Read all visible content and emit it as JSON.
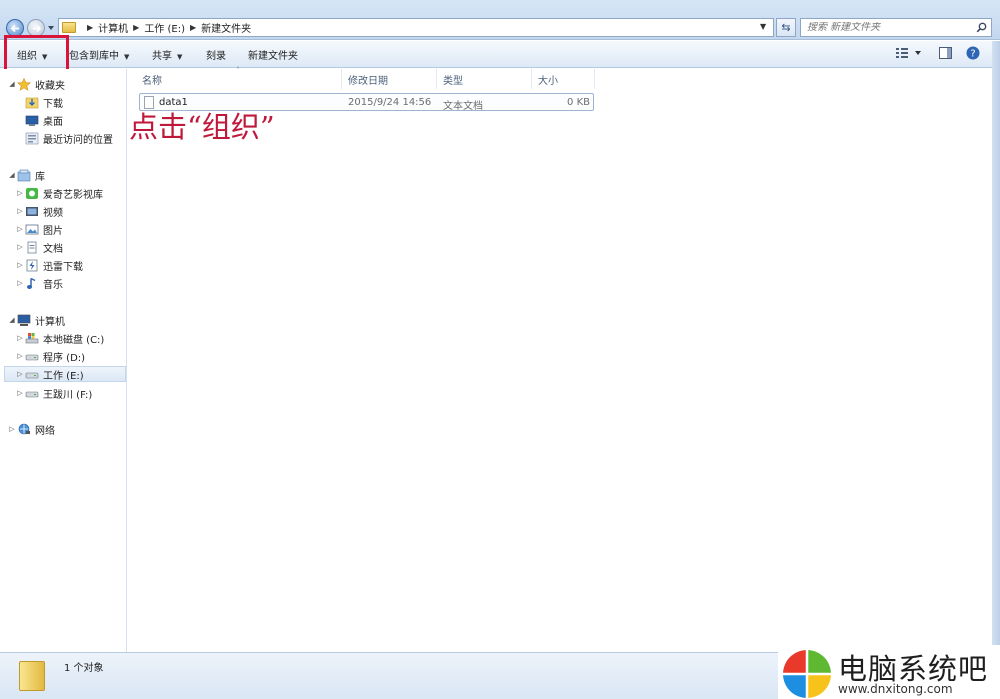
{
  "address": {
    "breadcrumbs": [
      "计算机",
      "工作 (E:)",
      "新建文件夹"
    ],
    "search_placeholder": "搜索 新建文件夹"
  },
  "toolbar": {
    "organize": "组织",
    "include_in_library": "包含到库中",
    "share": "共享",
    "burn": "刻录",
    "new_folder": "新建文件夹"
  },
  "sidebar": {
    "favorites": {
      "label": "收藏夹",
      "items": [
        "下载",
        "桌面",
        "最近访问的位置"
      ]
    },
    "libraries": {
      "label": "库",
      "items": [
        "爱奇艺影视库",
        "视频",
        "图片",
        "文档",
        "迅雷下载",
        "音乐"
      ]
    },
    "computer": {
      "label": "计算机",
      "items": [
        "本地磁盘 (C:)",
        "程序 (D:)",
        "工作 (E:)",
        "王跋川 (F:)"
      ]
    },
    "network": {
      "label": "网络"
    }
  },
  "columns": [
    "名称",
    "修改日期",
    "类型",
    "大小"
  ],
  "files": [
    {
      "name": "data1",
      "modified": "2015/9/24 14:56",
      "type": "文本文档",
      "size": "0 KB"
    }
  ],
  "annotation": "点击“组织”",
  "status": {
    "count": "1 个对象"
  },
  "watermark": {
    "title": "电脑系统吧",
    "url": "www.dnxitong.com"
  },
  "colors": {
    "highlight": "#d8143b",
    "annotation": "#c0183b"
  }
}
